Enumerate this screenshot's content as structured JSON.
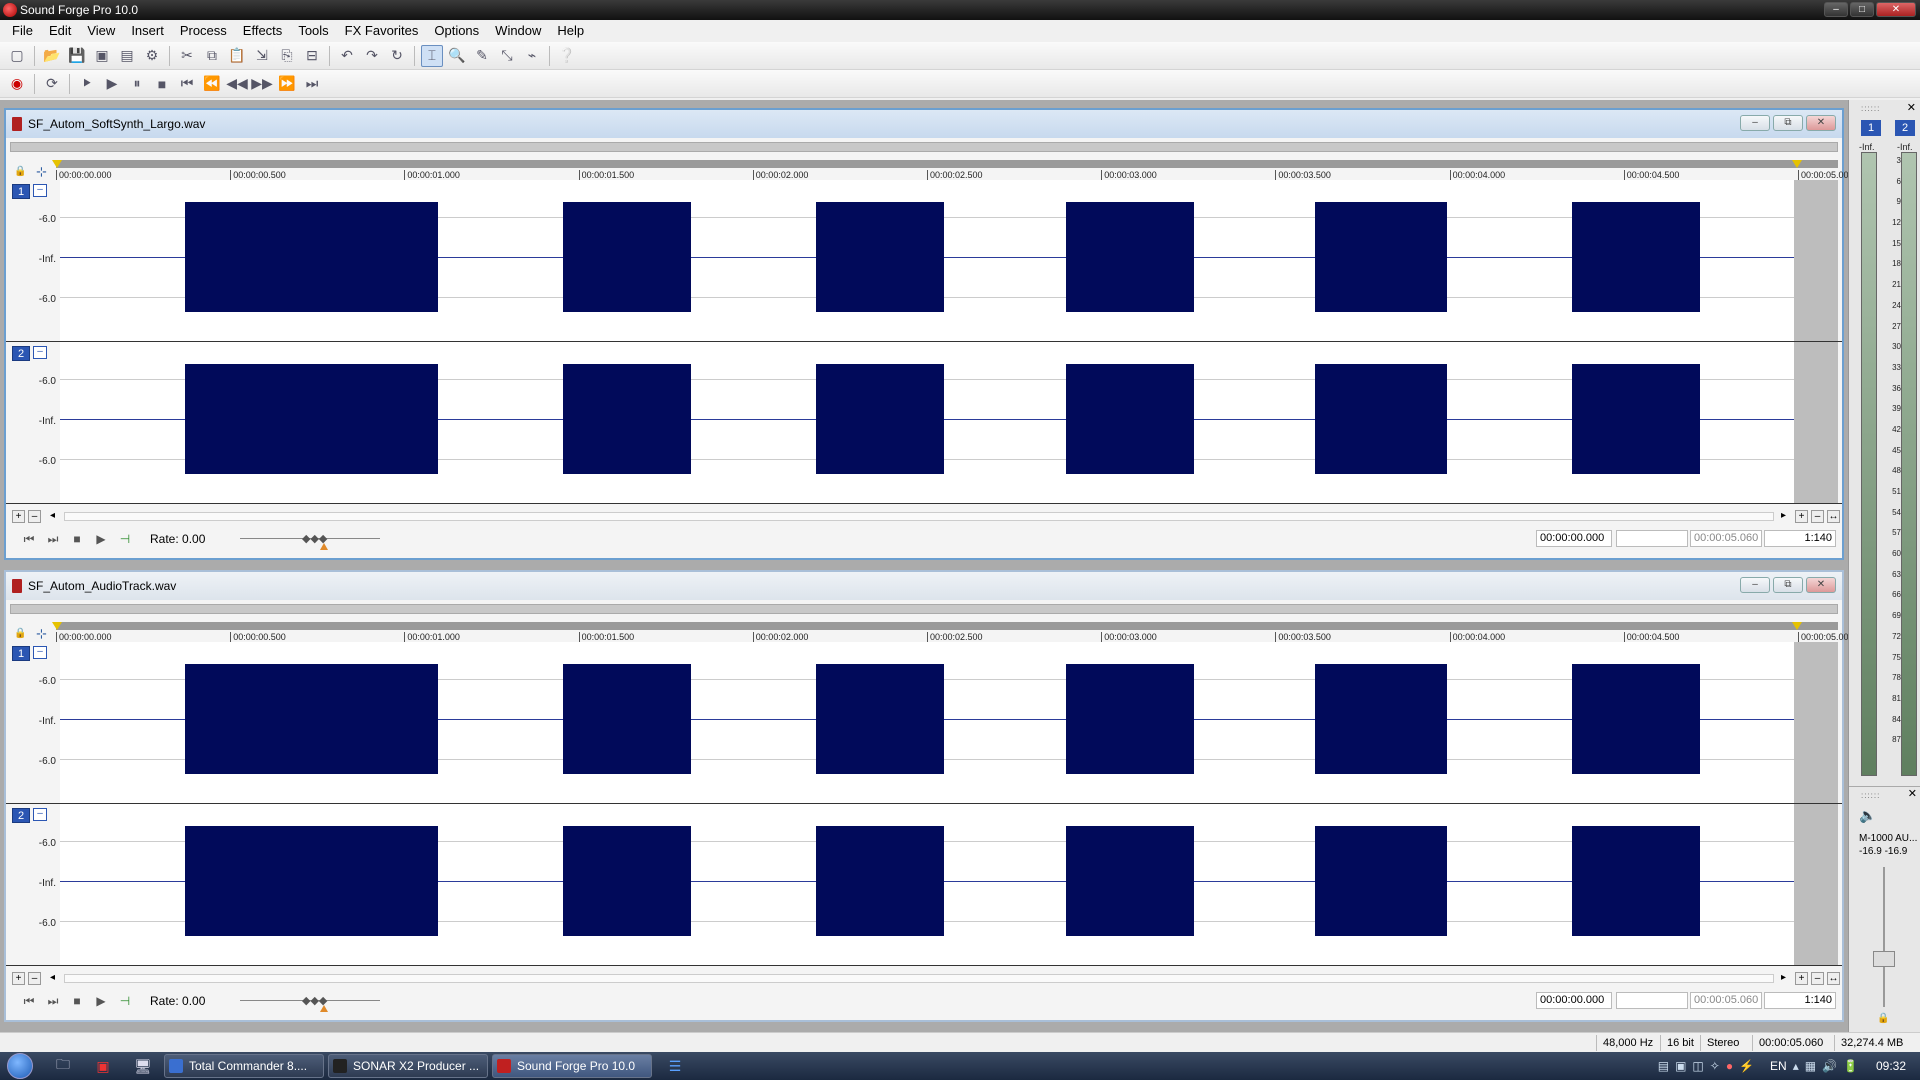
{
  "app": {
    "title": "Sound Forge Pro 10.0"
  },
  "menu": [
    "File",
    "Edit",
    "View",
    "Insert",
    "Process",
    "Effects",
    "Tools",
    "FX Favorites",
    "Options",
    "Window",
    "Help"
  ],
  "ruler_ticks": [
    "00:00:00.000",
    "00:00:00.500",
    "00:00:01.000",
    "00:00:01.500",
    "00:00:02.000",
    "00:00:02.500",
    "00:00:03.000",
    "00:00:03.500",
    "00:00:04.000",
    "00:00:04.500",
    "00:00:05.000"
  ],
  "db_labels": {
    "upper": "-6.0",
    "center": "-Inf.",
    "lower": "-6.0"
  },
  "documents": [
    {
      "title": "SF_Autom_SoftSynth_Largo.wav",
      "rate": "Rate: 0.00",
      "cursor_time": "00:00:00.000",
      "length": "00:00:05.060",
      "zoom": "1:140",
      "channels": [
        "1",
        "2"
      ]
    },
    {
      "title": "SF_Autom_AudioTrack.wav",
      "rate": "Rate: 0.00",
      "cursor_time": "00:00:00.000",
      "length": "00:00:05.060",
      "zoom": "1:140",
      "channels": [
        "1",
        "2"
      ]
    }
  ],
  "waveform_bursts_seconds": [
    [
      0.36,
      1.09
    ],
    [
      1.45,
      1.82
    ],
    [
      2.18,
      2.55
    ],
    [
      2.9,
      3.27
    ],
    [
      3.62,
      4.0
    ],
    [
      4.36,
      4.73
    ]
  ],
  "meters": {
    "channels": [
      "1",
      "2"
    ],
    "peak": [
      "-Inf.",
      "-Inf."
    ],
    "scale": [
      "3",
      "6",
      "9",
      "12",
      "15",
      "18",
      "21",
      "24",
      "27",
      "30",
      "33",
      "36",
      "39",
      "42",
      "45",
      "48",
      "51",
      "54",
      "57",
      "60",
      "63",
      "66",
      "69",
      "72",
      "75",
      "78",
      "81",
      "84",
      "87"
    ],
    "device": "M-1000 AU...",
    "device_levels": "-16.9 -16.9"
  },
  "status": {
    "sample_rate": "48,000 Hz",
    "bit_depth": "16 bit",
    "channels": "Stereo",
    "length": "00:00:05.060",
    "disk_space": "32,274.4 MB"
  },
  "taskbar": {
    "tasks": [
      {
        "label": "Total Commander 8....",
        "color": "#3a6fd0"
      },
      {
        "label": "SONAR X2 Producer ...",
        "color": "#222"
      },
      {
        "label": "Sound Forge Pro 10.0",
        "color": "#c02020"
      }
    ],
    "lang": "EN",
    "clock": "09:32"
  }
}
